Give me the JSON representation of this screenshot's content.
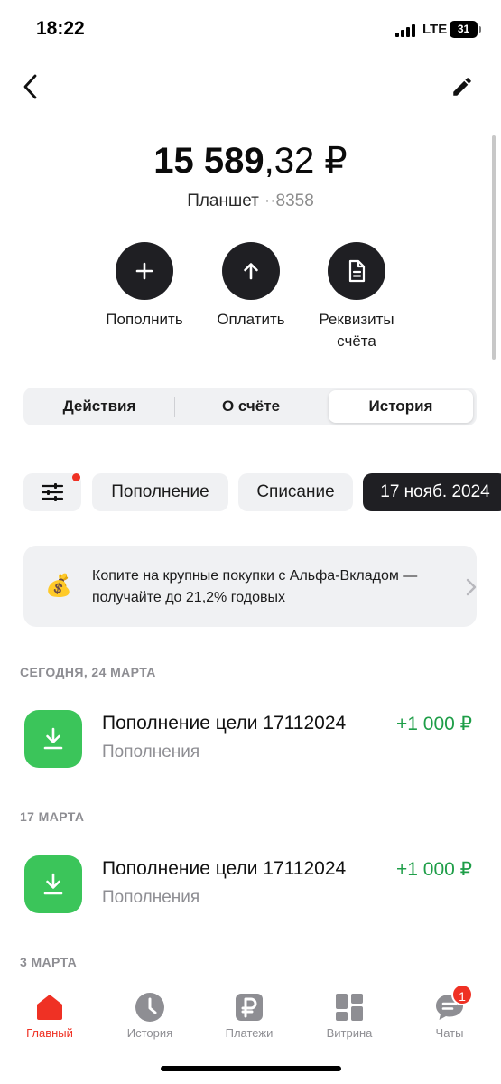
{
  "status_bar": {
    "time": "18:22",
    "network": "LTE",
    "battery": "31"
  },
  "account": {
    "balance_integer": "15 589",
    "balance_fraction": ",32 ₽",
    "name": "Планшет",
    "number_masked": "··8358"
  },
  "actions": [
    {
      "label": "Пополнить",
      "icon": "plus-icon"
    },
    {
      "label": "Оплатить",
      "icon": "arrow-up-icon"
    },
    {
      "label": "Реквизиты счёта",
      "icon": "document-icon"
    }
  ],
  "tabs": [
    {
      "label": "Действия"
    },
    {
      "label": "О счёте"
    },
    {
      "label": "История",
      "active": true
    }
  ],
  "filters": {
    "chips": [
      "Пополнение",
      "Списание",
      "17 нояб. 2024"
    ],
    "has_active_filter": true
  },
  "promo": {
    "icon": "money-bag-icon",
    "text": "Копите на крупные покупки с Альфа-Вкладом — получайте до 21,2% годовых"
  },
  "history": [
    {
      "date": "СЕГОДНЯ, 24 МАРТА",
      "operations": [
        {
          "title": "Пополнение цели 17112024",
          "category": "Пополнения",
          "amount": "+1 000 ₽"
        }
      ]
    },
    {
      "date": "17 МАРТА",
      "operations": [
        {
          "title": "Пополнение цели 17112024",
          "category": "Пополнения",
          "amount": "+1 000 ₽"
        }
      ]
    },
    {
      "date": "3 МАРТА",
      "operations": []
    }
  ],
  "tabbar": [
    {
      "label": "Главный",
      "icon": "home-icon",
      "active": true
    },
    {
      "label": "История",
      "icon": "clock-icon"
    },
    {
      "label": "Платежи",
      "icon": "ruble-icon"
    },
    {
      "label": "Витрина",
      "icon": "grid-icon"
    },
    {
      "label": "Чаты",
      "icon": "chat-icon",
      "badge": "1"
    }
  ],
  "colors": {
    "accent_red": "#ef3124",
    "income_green": "#1e9e48",
    "topup_icon_bg": "#3bc55a",
    "dark_button": "#1f1f23"
  }
}
